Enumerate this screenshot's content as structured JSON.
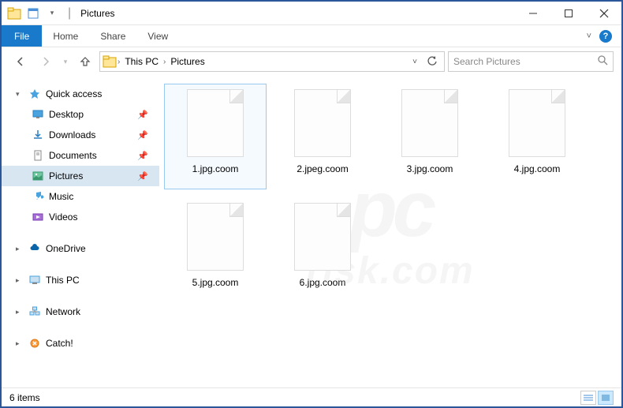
{
  "window": {
    "title": "Pictures"
  },
  "ribbon": {
    "file": "File",
    "tabs": [
      "Home",
      "Share",
      "View"
    ]
  },
  "breadcrumbs": [
    "This PC",
    "Pictures"
  ],
  "search": {
    "placeholder": "Search Pictures"
  },
  "sidebar": {
    "quick_access": {
      "label": "Quick access",
      "items": [
        {
          "label": "Desktop",
          "pinned": true,
          "icon": "desktop"
        },
        {
          "label": "Downloads",
          "pinned": true,
          "icon": "downloads"
        },
        {
          "label": "Documents",
          "pinned": true,
          "icon": "documents"
        },
        {
          "label": "Pictures",
          "pinned": true,
          "icon": "pictures",
          "active": true
        },
        {
          "label": "Music",
          "pinned": false,
          "icon": "music"
        },
        {
          "label": "Videos",
          "pinned": false,
          "icon": "videos"
        }
      ]
    },
    "roots": [
      {
        "label": "OneDrive",
        "icon": "onedrive"
      },
      {
        "label": "This PC",
        "icon": "thispc"
      },
      {
        "label": "Network",
        "icon": "network"
      },
      {
        "label": "Catch!",
        "icon": "catch"
      }
    ]
  },
  "files": [
    {
      "name": "1.jpg.coom",
      "selected": true
    },
    {
      "name": "2.jpeg.coom",
      "selected": false
    },
    {
      "name": "3.jpg.coom",
      "selected": false
    },
    {
      "name": "4.jpg.coom",
      "selected": false
    },
    {
      "name": "5.jpg.coom",
      "selected": false
    },
    {
      "name": "6.jpg.coom",
      "selected": false
    }
  ],
  "status": {
    "count": "6 items"
  },
  "watermark": {
    "main": "pc",
    "sub": "risk.com"
  }
}
